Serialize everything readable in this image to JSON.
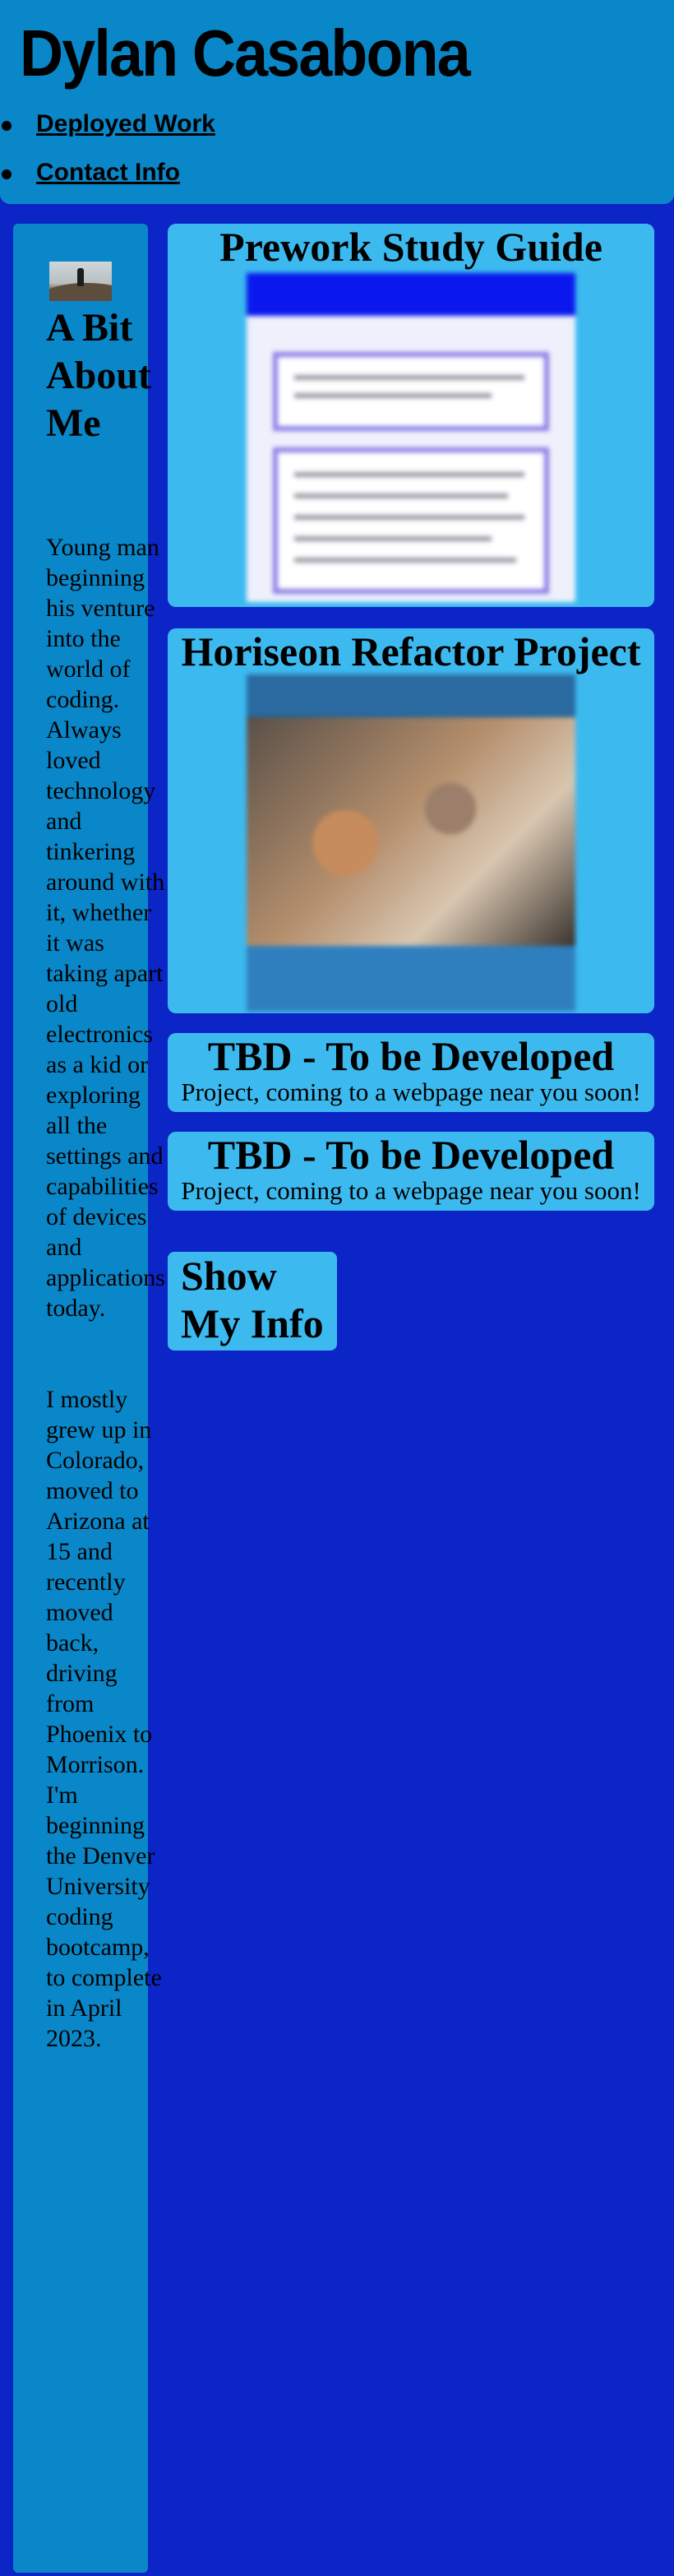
{
  "header": {
    "title": "Dylan Casabona",
    "nav": [
      {
        "label": "Deployed Work"
      },
      {
        "label": "Contact Info"
      }
    ]
  },
  "about": {
    "heading": "A Bit About Me",
    "paragraph_1": "Young man beginning his venture into the world of coding. Always loved technology and tinkering around with it, whether it was taking apart old electronics as a kid or exploring all the settings and capabilities of devices and applications today.",
    "paragraph_2": "I mostly grew up in Colorado, moved to Arizona at 15 and recently moved back, driving from Phoenix to Morrison. I'm beginning the Denver University coding bootcamp, to complete in April 2023."
  },
  "projects": [
    {
      "title": "Prework Study Guide"
    },
    {
      "title": "Horiseon Refactor Project"
    },
    {
      "title": "TBD - To be Developed",
      "description": "Project, coming to a webpage near you soon!"
    },
    {
      "title": "TBD - To be Developed",
      "description": "Project, coming to a webpage near you soon!"
    }
  ],
  "show_info_button": {
    "label": "Show My Info"
  },
  "colors": {
    "page_background": "#0c25c6",
    "header_background": "#0a87c8",
    "card_background": "#3cbaf0"
  }
}
